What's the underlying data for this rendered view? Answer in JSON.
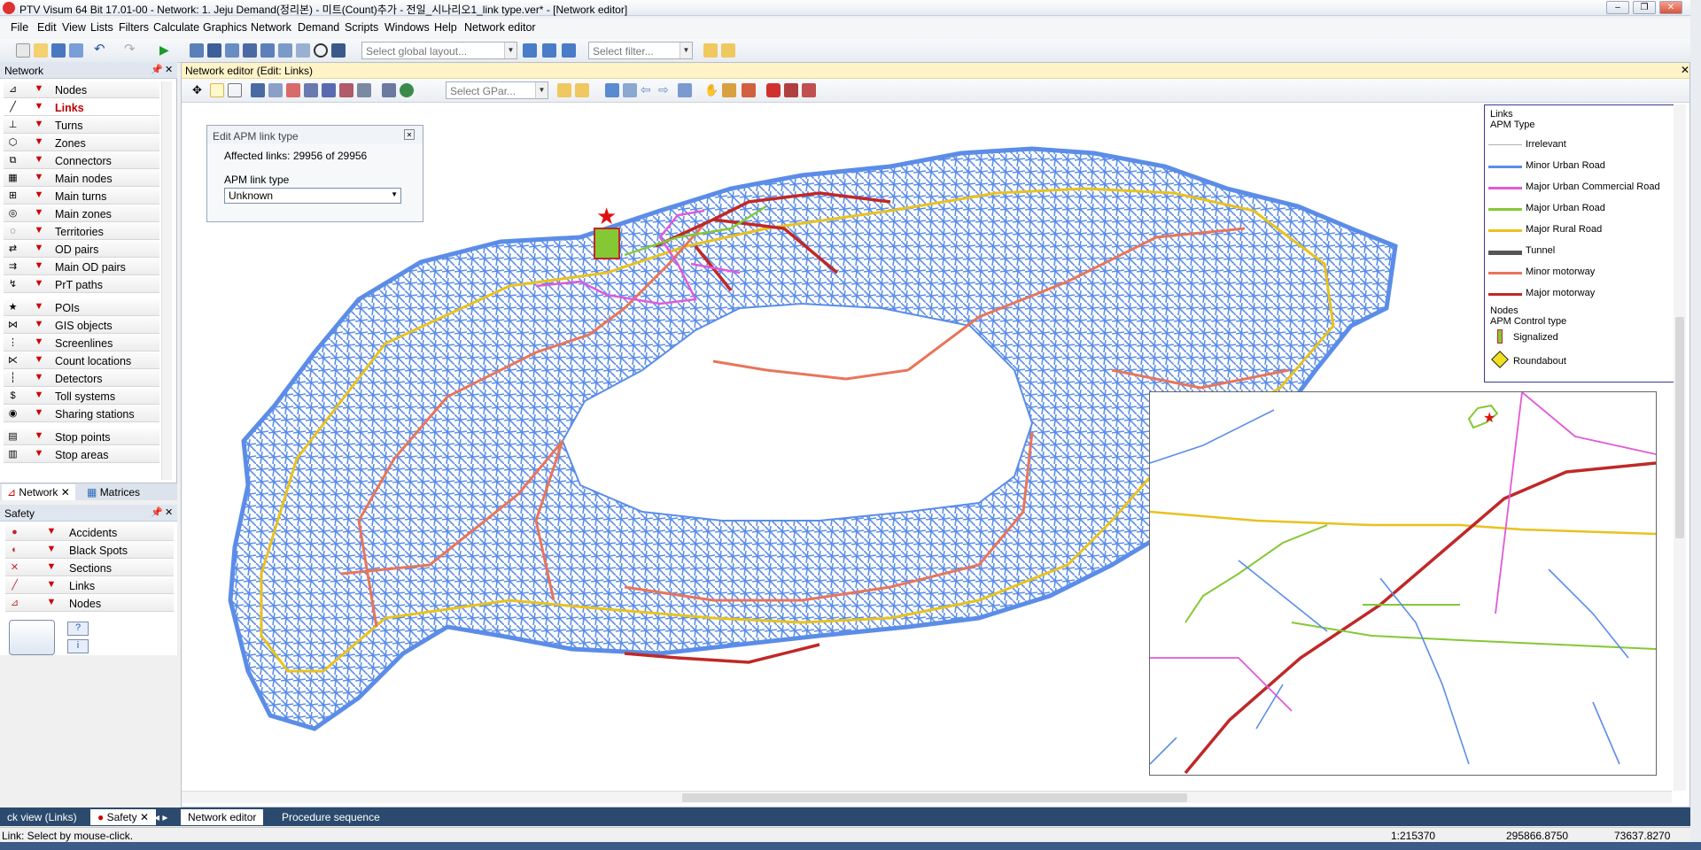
{
  "window": {
    "title": "PTV Visum 64 Bit 17.01-00 - Network: 1. Jeju Demand(정리본) - 미트(Count)추가 - 전일_시나리오1_link type.ver* - [Network editor]"
  },
  "menu": [
    "File",
    "Edit",
    "View",
    "Lists",
    "Filters",
    "Calculate",
    "Graphics",
    "Network",
    "Demand",
    "Scripts",
    "Windows",
    "Help",
    "Network editor"
  ],
  "toolbar": {
    "layout_placeholder": "Select global layout...",
    "filter_placeholder": "Select filter..."
  },
  "network_panel": {
    "title": "Network",
    "items": [
      {
        "label": "Nodes",
        "icon": "node-icon"
      },
      {
        "label": "Links",
        "icon": "link-icon",
        "selected": true
      },
      {
        "label": "Turns",
        "icon": "turn-icon"
      },
      {
        "label": "Zones",
        "icon": "zone-icon"
      },
      {
        "label": "Connectors",
        "icon": "connector-icon"
      },
      {
        "label": "Main nodes",
        "icon": "main-node-icon"
      },
      {
        "label": "Main turns",
        "icon": "main-turn-icon"
      },
      {
        "label": "Main zones",
        "icon": "main-zone-icon"
      },
      {
        "label": "Territories",
        "icon": "territory-icon"
      },
      {
        "label": "OD pairs",
        "icon": "od-pair-icon"
      },
      {
        "label": "Main OD pairs",
        "icon": "main-od-pair-icon"
      },
      {
        "label": "PrT paths",
        "icon": "prt-path-icon"
      },
      {
        "label": "POIs",
        "icon": "poi-icon"
      },
      {
        "label": "GIS objects",
        "icon": "gis-icon"
      },
      {
        "label": "Screenlines",
        "icon": "screenline-icon"
      },
      {
        "label": "Count locations",
        "icon": "count-location-icon"
      },
      {
        "label": "Detectors",
        "icon": "detector-icon"
      },
      {
        "label": "Toll systems",
        "icon": "toll-icon"
      },
      {
        "label": "Sharing stations",
        "icon": "sharing-icon"
      },
      {
        "label": "Stop points",
        "icon": "stop-point-icon"
      },
      {
        "label": "Stop areas",
        "icon": "stop-area-icon"
      }
    ],
    "tabs": [
      "Network",
      "Matrices"
    ]
  },
  "safety_panel": {
    "title": "Safety",
    "items": [
      "Accidents",
      "Black Spots",
      "Sections",
      "Links",
      "Nodes"
    ]
  },
  "editor": {
    "title": "Network editor (Edit: Links)",
    "gpar_placeholder": "Select GPar...",
    "dialog": {
      "title": "Edit APM link type",
      "affected": "Affected links: 29956 of 29956",
      "field_label": "APM link type",
      "field_value": "Unknown"
    }
  },
  "legend": {
    "links_title": "Links",
    "apm_type_title": "APM Type",
    "entries": [
      {
        "label": "Irrelevant",
        "color": "#b0b0b0"
      },
      {
        "label": "Minor Urban Road",
        "color": "#5b8de8"
      },
      {
        "label": "Major Urban Commercial Road",
        "color": "#e05ad8"
      },
      {
        "label": "Major Urban Road",
        "color": "#84c834"
      },
      {
        "label": "Major Rural Road",
        "color": "#e8c21e"
      },
      {
        "label": "Tunnel",
        "color": "#555555"
      },
      {
        "label": "Minor motorway",
        "color": "#e8755a"
      },
      {
        "label": "Major motorway",
        "color": "#c02828"
      }
    ],
    "nodes_title": "Nodes",
    "control_title": "APM Control type",
    "node_entries": [
      "Signalized",
      "Roundabout"
    ]
  },
  "bottom_tabs": [
    "ck view (Links)",
    "Safety",
    "Network editor",
    "Procedure sequence"
  ],
  "status": {
    "message": "Link: Select by mouse-click.",
    "scale": "1:215370",
    "x": "295866.8750",
    "y": "73637.8270"
  }
}
